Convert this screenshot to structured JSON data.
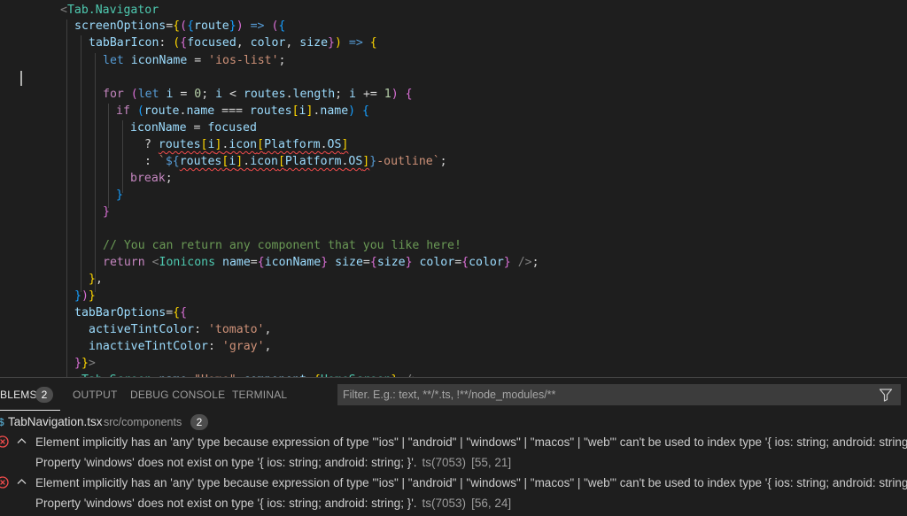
{
  "editor": {
    "lines": [
      [
        [
          "pun",
          "<"
        ],
        [
          "tag",
          "Tab.Navigator"
        ]
      ],
      [
        [
          "var",
          "screenOptions"
        ],
        [
          "plain",
          "="
        ],
        [
          "br1",
          "{"
        ],
        [
          "br2",
          "("
        ],
        [
          "br3",
          "{"
        ],
        [
          "var",
          "route"
        ],
        [
          "br3",
          "}"
        ],
        [
          "br2",
          ")"
        ],
        [
          "plain",
          " "
        ],
        [
          "kw",
          "=>"
        ],
        [
          "plain",
          " "
        ],
        [
          "br2",
          "("
        ],
        [
          "br3",
          "{"
        ]
      ],
      [
        [
          "var",
          "tabBarIcon"
        ],
        [
          "plain",
          ": "
        ],
        [
          "br1",
          "("
        ],
        [
          "br2",
          "{"
        ],
        [
          "var",
          "focused"
        ],
        [
          "plain",
          ", "
        ],
        [
          "var",
          "color"
        ],
        [
          "plain",
          ", "
        ],
        [
          "var",
          "size"
        ],
        [
          "br2",
          "}"
        ],
        [
          "br1",
          ")"
        ],
        [
          "plain",
          " "
        ],
        [
          "kw",
          "=>"
        ],
        [
          "plain",
          " "
        ],
        [
          "br1",
          "{"
        ]
      ],
      [
        [
          "kw",
          "let"
        ],
        [
          "plain",
          " "
        ],
        [
          "var",
          "iconName"
        ],
        [
          "plain",
          " = "
        ],
        [
          "str",
          "'ios-list'"
        ],
        [
          "plain",
          ";"
        ]
      ],
      [],
      [
        [
          "ctl",
          "for"
        ],
        [
          "plain",
          " "
        ],
        [
          "br2",
          "("
        ],
        [
          "kw",
          "let"
        ],
        [
          "plain",
          " "
        ],
        [
          "var",
          "i"
        ],
        [
          "plain",
          " = "
        ],
        [
          "num",
          "0"
        ],
        [
          "plain",
          "; "
        ],
        [
          "var",
          "i"
        ],
        [
          "plain",
          " < "
        ],
        [
          "var",
          "routes"
        ],
        [
          "plain",
          "."
        ],
        [
          "var",
          "length"
        ],
        [
          "plain",
          "; "
        ],
        [
          "var",
          "i"
        ],
        [
          "plain",
          " += "
        ],
        [
          "num",
          "1"
        ],
        [
          "br2",
          ")"
        ],
        [
          "plain",
          " "
        ],
        [
          "br2",
          "{"
        ]
      ],
      [
        [
          "ctl",
          "if"
        ],
        [
          "plain",
          " "
        ],
        [
          "br3",
          "("
        ],
        [
          "var",
          "route"
        ],
        [
          "plain",
          "."
        ],
        [
          "var",
          "name"
        ],
        [
          "plain",
          " === "
        ],
        [
          "var",
          "routes"
        ],
        [
          "br1",
          "["
        ],
        [
          "var",
          "i"
        ],
        [
          "br1",
          "]"
        ],
        [
          "plain",
          "."
        ],
        [
          "var",
          "name"
        ],
        [
          "br3",
          ")"
        ],
        [
          "plain",
          " "
        ],
        [
          "br3",
          "{"
        ]
      ],
      [
        [
          "var",
          "iconName"
        ],
        [
          "plain",
          " = "
        ],
        [
          "var",
          "focused"
        ]
      ],
      [
        [
          "plain",
          "? "
        ],
        [
          "var",
          "routes",
          "sq"
        ],
        [
          "br1",
          "[",
          "sq"
        ],
        [
          "var",
          "i",
          "sq"
        ],
        [
          "br1",
          "]",
          "sq"
        ],
        [
          "plain",
          ".",
          "sq"
        ],
        [
          "var",
          "icon",
          "sq"
        ],
        [
          "br1",
          "[",
          "sq"
        ],
        [
          "var",
          "Platform",
          "sq"
        ],
        [
          "plain",
          ".",
          "sq"
        ],
        [
          "var",
          "OS",
          "sq"
        ],
        [
          "br1",
          "]",
          "sq"
        ]
      ],
      [
        [
          "plain",
          ": "
        ],
        [
          "str",
          "`"
        ],
        [
          "kw",
          "${"
        ],
        [
          "var",
          "routes",
          "sq"
        ],
        [
          "br1",
          "[",
          "sq"
        ],
        [
          "var",
          "i",
          "sq"
        ],
        [
          "br1",
          "]",
          "sq"
        ],
        [
          "plain",
          ".",
          "sq"
        ],
        [
          "var",
          "icon",
          "sq"
        ],
        [
          "br1",
          "[",
          "sq"
        ],
        [
          "var",
          "Platform",
          "sq"
        ],
        [
          "plain",
          ".",
          "sq"
        ],
        [
          "var",
          "OS",
          "sq"
        ],
        [
          "br1",
          "]",
          "sq"
        ],
        [
          "kw",
          "}"
        ],
        [
          "str",
          "-outline`"
        ],
        [
          "plain",
          ";"
        ]
      ],
      [
        [
          "ctl",
          "break"
        ],
        [
          "plain",
          ";"
        ]
      ],
      [
        [
          "br3",
          "}"
        ]
      ],
      [
        [
          "br2",
          "}"
        ]
      ],
      [],
      [
        [
          "cmt",
          "// You can return any component that you like here!"
        ]
      ],
      [
        [
          "ctl",
          "return"
        ],
        [
          "plain",
          " "
        ],
        [
          "pun",
          "<"
        ],
        [
          "tag",
          "Ionicons"
        ],
        [
          "plain",
          " "
        ],
        [
          "var",
          "name"
        ],
        [
          "plain",
          "="
        ],
        [
          "br2",
          "{"
        ],
        [
          "var",
          "iconName"
        ],
        [
          "br2",
          "}"
        ],
        [
          "plain",
          " "
        ],
        [
          "var",
          "size"
        ],
        [
          "plain",
          "="
        ],
        [
          "br2",
          "{"
        ],
        [
          "var",
          "size"
        ],
        [
          "br2",
          "}"
        ],
        [
          "plain",
          " "
        ],
        [
          "var",
          "color"
        ],
        [
          "plain",
          "="
        ],
        [
          "br2",
          "{"
        ],
        [
          "var",
          "color"
        ],
        [
          "br2",
          "}"
        ],
        [
          "plain",
          " "
        ],
        [
          "pun",
          "/>"
        ],
        [
          "plain",
          ";"
        ]
      ],
      [
        [
          "br1",
          "}"
        ],
        [
          "plain",
          ","
        ]
      ],
      [
        [
          "br3",
          "}"
        ],
        [
          "br2",
          ")"
        ],
        [
          "br1",
          "}"
        ]
      ],
      [
        [
          "var",
          "tabBarOptions"
        ],
        [
          "plain",
          "="
        ],
        [
          "br1",
          "{"
        ],
        [
          "br2",
          "{"
        ]
      ],
      [
        [
          "var",
          "activeTintColor"
        ],
        [
          "plain",
          ": "
        ],
        [
          "str",
          "'tomato'"
        ],
        [
          "plain",
          ","
        ]
      ],
      [
        [
          "var",
          "inactiveTintColor"
        ],
        [
          "plain",
          ": "
        ],
        [
          "str",
          "'gray'"
        ],
        [
          "plain",
          ","
        ]
      ],
      [
        [
          "br2",
          "}"
        ],
        [
          "br1",
          "}"
        ],
        [
          "pun",
          ">"
        ]
      ],
      [
        [
          "pun",
          "<"
        ],
        [
          "tag",
          "Tab.Screen"
        ],
        [
          "plain",
          " "
        ],
        [
          "var",
          "name"
        ],
        [
          "plain",
          "="
        ],
        [
          "str",
          "\"Home\""
        ],
        [
          "plain",
          " "
        ],
        [
          "var",
          "component"
        ],
        [
          "plain",
          "="
        ],
        [
          "br1",
          "{"
        ],
        [
          "tag",
          "HomeScreen"
        ],
        [
          "br1",
          "}"
        ],
        [
          "plain",
          " "
        ],
        [
          "pun",
          "/>"
        ]
      ]
    ]
  },
  "panel": {
    "tabs": {
      "problems": "BLEMS",
      "problems_count": "2",
      "output": "OUTPUT",
      "debug_console": "DEBUG CONSOLE",
      "terminal": "TERMINAL"
    },
    "filter_placeholder": "Filter. E.g.: text, **/*.ts, !**/node_modules/**",
    "file": {
      "icon": "ts-file-icon",
      "name": "TabNavigation.tsx",
      "path": "src/components",
      "count": "2"
    },
    "problems": [
      {
        "message": "Element implicitly has an 'any' type because expression of type '\"ios\" | \"android\" | \"windows\" | \"macos\" | \"web\"' can't be used to index type '{ ios: string; android: string; }'.",
        "detail": "Property 'windows' does not exist on type '{ ios: string; android: string; }'.",
        "code": "ts(7053)",
        "position": "[55, 21]"
      },
      {
        "message": "Element implicitly has an 'any' type because expression of type '\"ios\" | \"android\" | \"windows\" | \"macos\" | \"web\"' can't be used to index type '{ ios: string; android: string; }'.",
        "detail": "Property 'windows' does not exist on type '{ ios: string; android: string; }'.",
        "code": "ts(7053)",
        "position": "[56, 24]"
      }
    ],
    "colors": {
      "error": "#f14c4c",
      "accent": "#e7e7e7"
    }
  }
}
